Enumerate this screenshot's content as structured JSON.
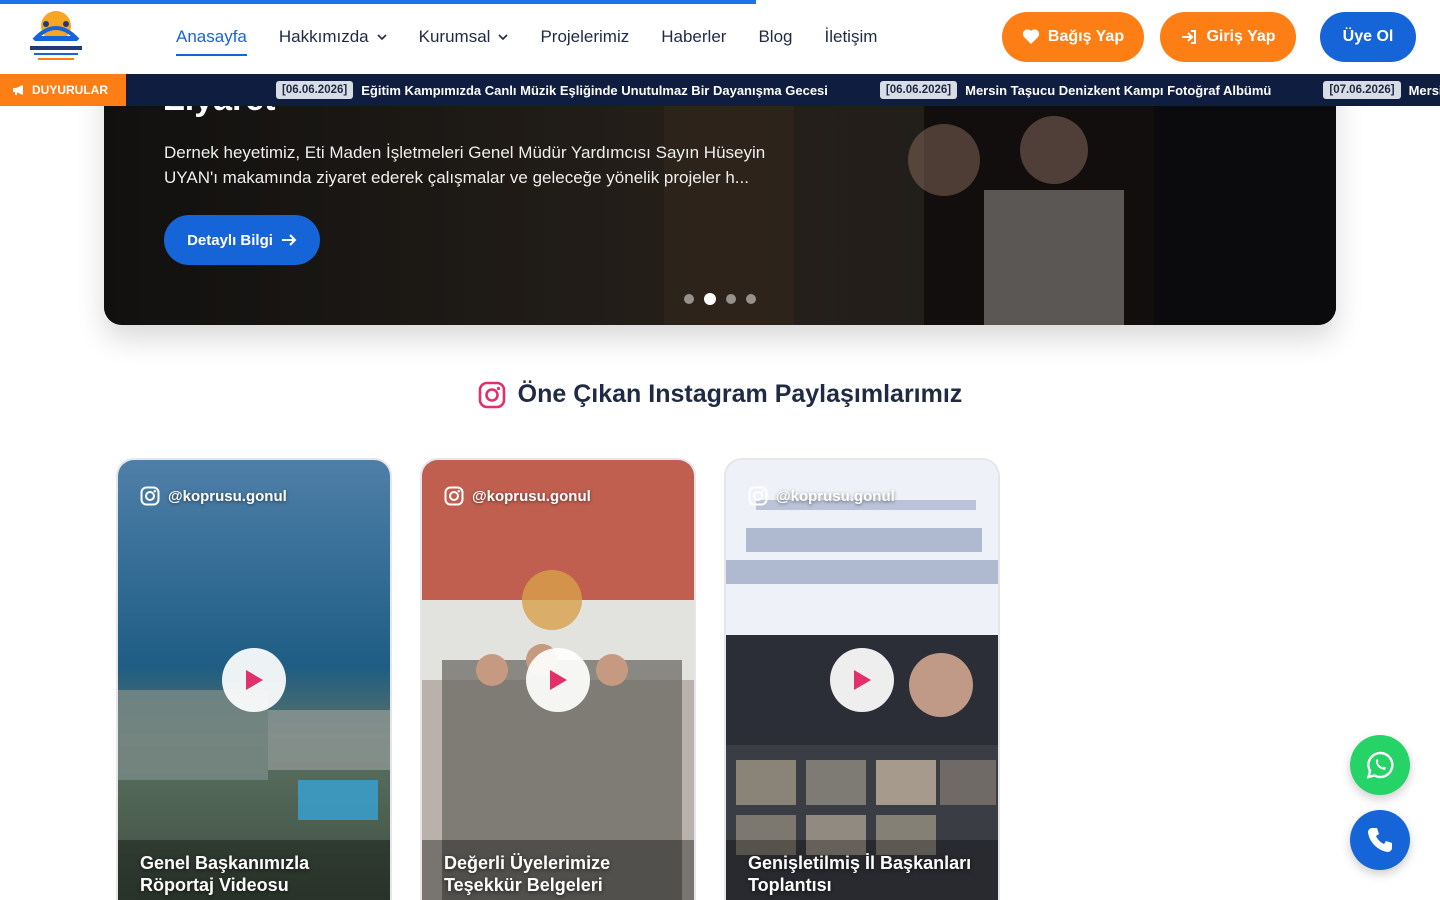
{
  "header": {
    "nav": [
      {
        "label": "Anasayfa"
      },
      {
        "label": "Hakkımızda"
      },
      {
        "label": "Kurumsal"
      },
      {
        "label": "Projelerimiz"
      },
      {
        "label": "Haberler"
      },
      {
        "label": "Blog"
      },
      {
        "label": "İletişim"
      }
    ],
    "donate_label": "Bağış Yap",
    "login_label": "Giriş Yap",
    "signup_label": "Üye Ol"
  },
  "ticker": {
    "label": "DUYURULAR",
    "items": [
      {
        "date": "[06.06.2026]",
        "text": "Eğitim Kampımızda Canlı Müzik Eşliğinde Unutulmaz Bir Dayanışma Gecesi"
      },
      {
        "date": "[06.06.2026]",
        "text": "Mersin Taşucu Denizkent Kampı Fotoğraf Albümü"
      },
      {
        "date": "[07.06.2026]",
        "text": "Mersin Taşucu Denizkent Kampı"
      }
    ]
  },
  "slider": {
    "title": "Ziyaret",
    "description": "Dernek heyetimiz, Eti Maden İşletmeleri Genel Müdür Yardımcısı Sayın Hüseyin UYAN'ı makamında ziyaret ederek çalışmalar ve geleceğe yönelik projeler h...",
    "button_label": "Detaylı Bilgi",
    "active_dot": 2,
    "dot_count": 4
  },
  "instagram": {
    "title": "Öne Çıkan Instagram Paylaşımlarımız",
    "cards": [
      {
        "handle": "@koprusu.gonul",
        "caption": "Genel Başkanımızla Röportaj Videosu"
      },
      {
        "handle": "@koprusu.gonul",
        "caption": "Değerli Üyelerimize Teşekkür Belgeleri"
      },
      {
        "handle": "@koprusu.gonul",
        "caption": "Genişletilmiş İl Başkanları Toplantısı"
      }
    ]
  },
  "colors": {
    "primary": "#1565d8",
    "accent": "#fd7e14",
    "navy": "#0f1d40",
    "whatsapp": "#25d366",
    "instagram": "#e1306c"
  }
}
